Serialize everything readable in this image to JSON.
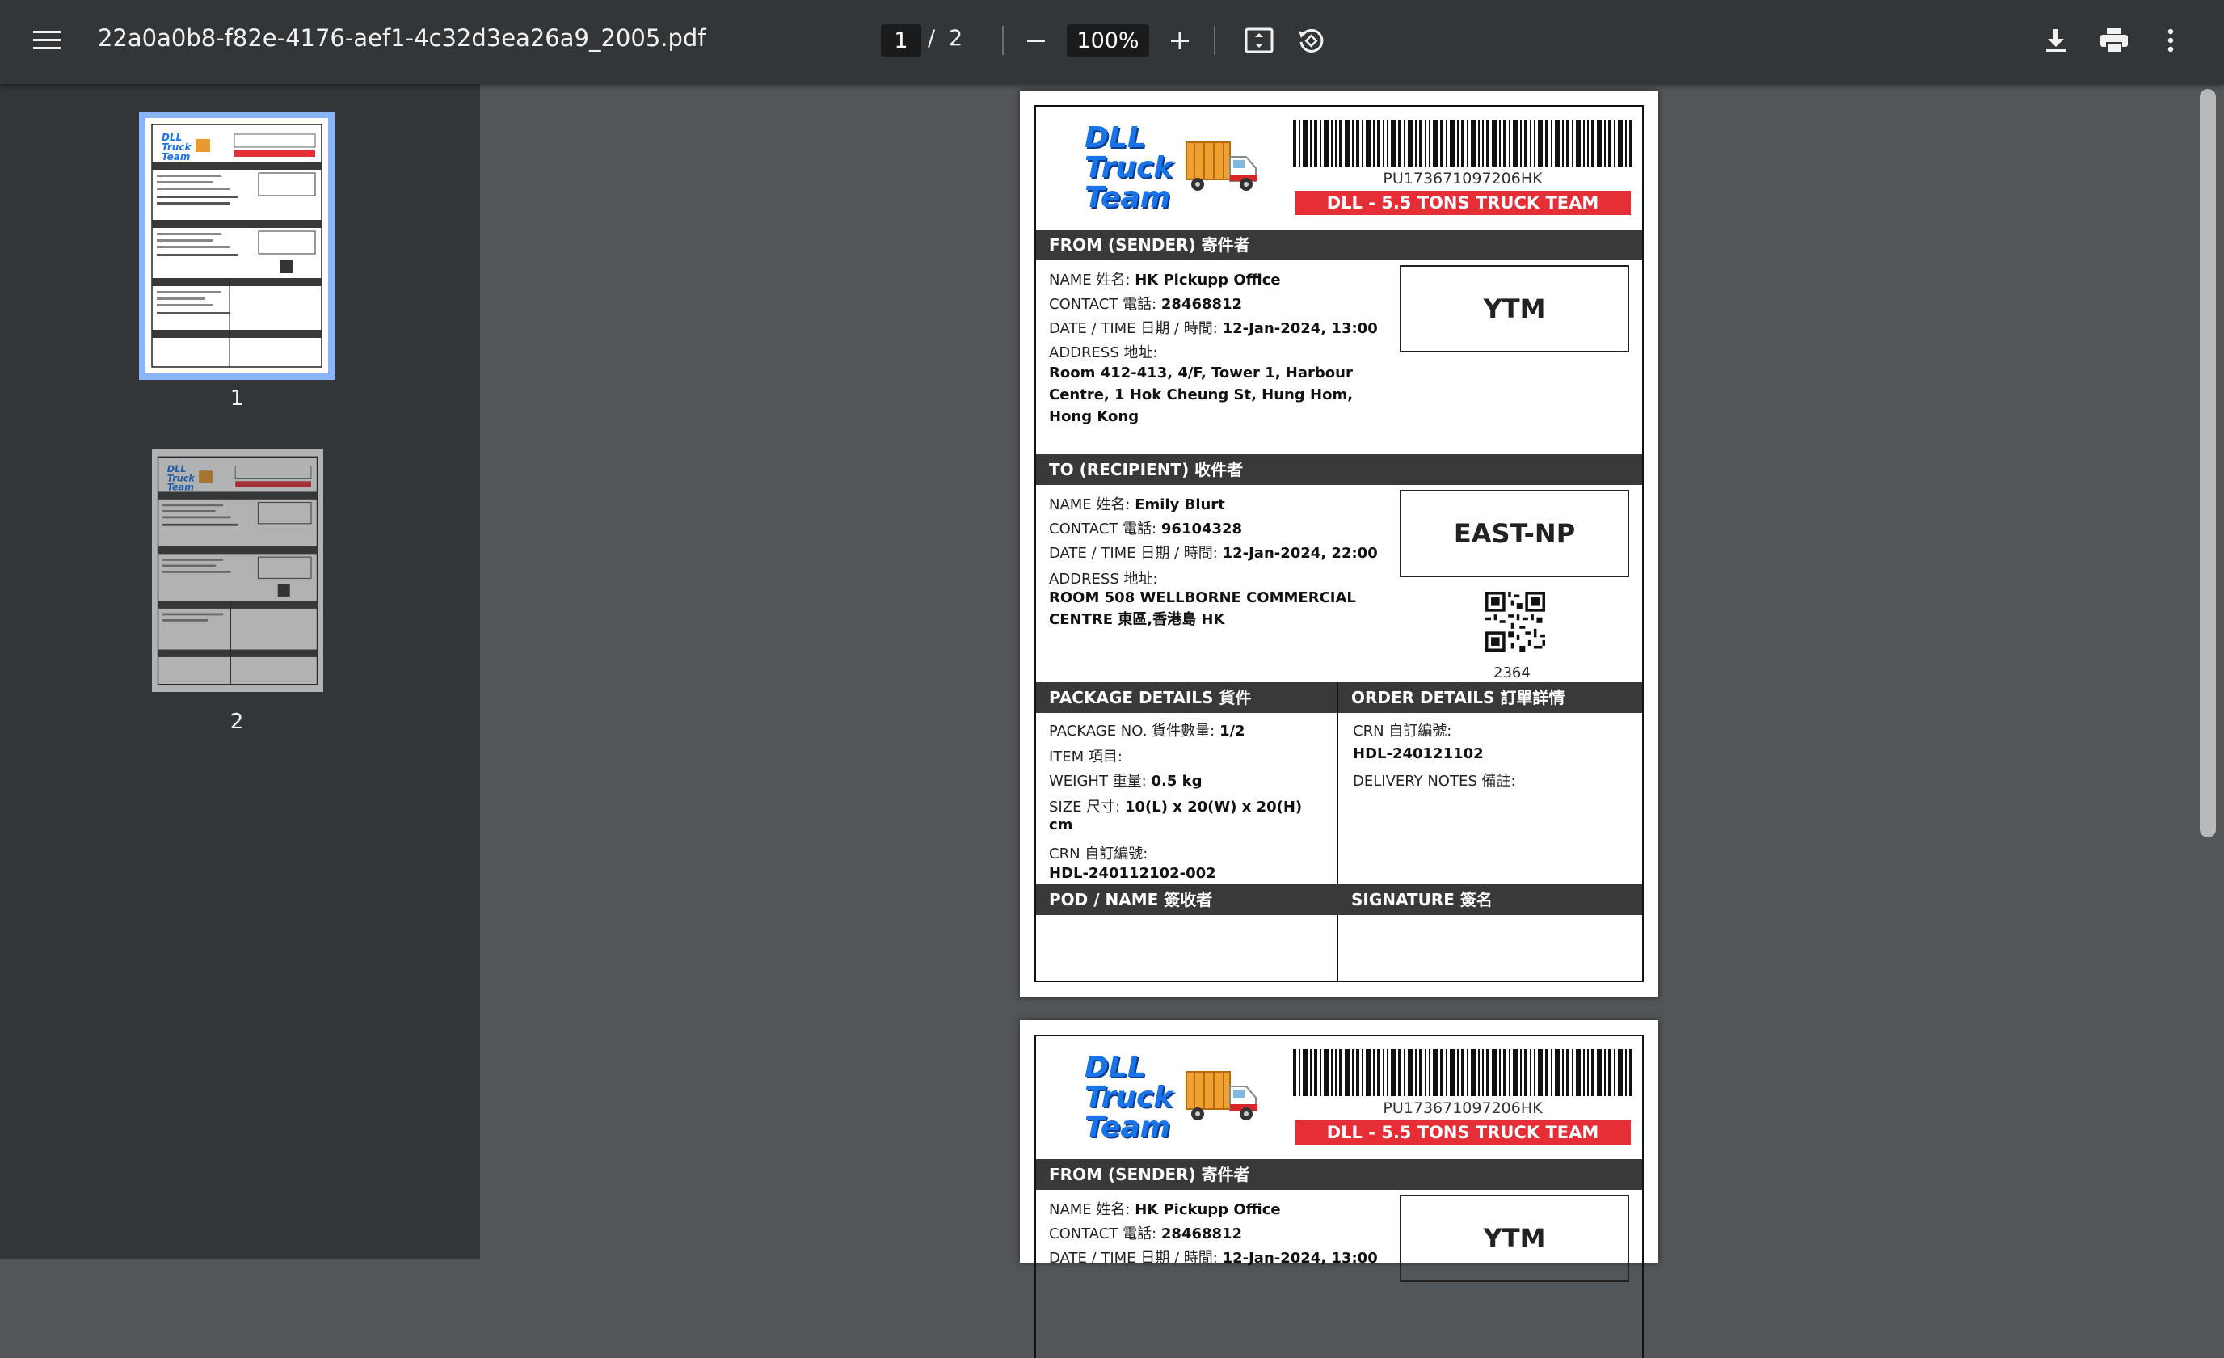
{
  "toolbar": {
    "file_name": "22a0a0b8-f82e-4176-aef1-4c32d3ea26a9_2005.pdf",
    "current_page": "1",
    "page_sep": "/",
    "total_pages": "2",
    "zoom": "100%"
  },
  "thumbnails": [
    {
      "number": "1",
      "selected": true
    },
    {
      "number": "2",
      "selected": false
    }
  ],
  "label": {
    "logo": "DLL Truck Team",
    "tracking_no": "PU173671097206HK",
    "banner": "DLL - 5.5 TONS TRUCK TEAM",
    "sender": {
      "header": "FROM (SENDER) 寄件者",
      "name_label": "NAME 姓名:",
      "name": "HK Pickupp Office",
      "contact_label": "CONTACT 電話:",
      "contact": "28468812",
      "datetime_label": "DATE / TIME 日期 / 時間:",
      "datetime": "12-Jan-2024, 13:00",
      "address_label": "ADDRESS 地址:",
      "address": "Room 412-413, 4/F, Tower 1, Harbour Centre, 1 Hok Cheung St, Hung Hom, Hong Kong",
      "code": "YTM"
    },
    "recipient": {
      "header": "TO (RECIPIENT) 收件者",
      "name_label": "NAME 姓名:",
      "name": "Emily Blurt",
      "contact_label": "CONTACT 電話:",
      "contact": "96104328",
      "datetime_label": "DATE / TIME 日期 / 時間:",
      "datetime": "12-Jan-2024, 22:00",
      "address_label": "ADDRESS 地址:",
      "address": "ROOM 508 WELLBORNE COMMERCIAL CENTRE 東區,香港島 HK",
      "code": "EAST-NP",
      "qr_number": "2364"
    },
    "package": {
      "header": "PACKAGE DETAILS 貨件",
      "package_no_label": "PACKAGE NO. 貨件數量:",
      "package_no": "1/2",
      "item_label": "ITEM 項目:",
      "weight_label": "WEIGHT 重量:",
      "weight": "0.5 kg",
      "size_label": "SIZE 尺寸:",
      "size": "10(L) x 20(W) x 20(H)",
      "size_unit": "cm",
      "crn_label": "CRN 自訂編號:",
      "crn": "HDL-240112102-002"
    },
    "order": {
      "header": "ORDER DETAILS 訂單詳情",
      "crn_label": "CRN 自訂編號:",
      "crn": "HDL-240121102",
      "notes_label": "DELIVERY NOTES 備註:"
    },
    "pod_header": "POD / NAME 簽收者",
    "signature_header": "SIGNATURE 簽名"
  }
}
